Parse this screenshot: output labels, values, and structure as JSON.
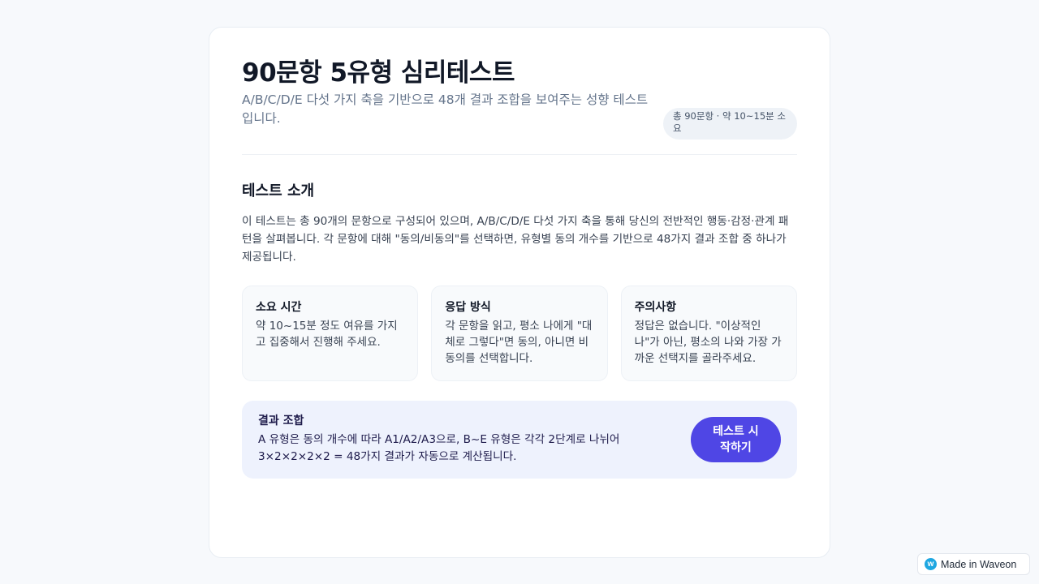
{
  "header": {
    "title": "90문항 5유형 심리테스트",
    "subtitle": "A/B/C/D/E 다섯 가지 축을 기반으로 48개 결과 조합을 보여주는 성향 테스트입니다.",
    "badge": "총 90문항 · 약 10~15분 소요"
  },
  "intro": {
    "title": "테스트 소개",
    "text": "이 테스트는 총 90개의 문항으로 구성되어 있으며, A/B/C/D/E 다섯 가지 축을 통해 당신의 전반적인 행동·감정·관계 패턴을 살펴봅니다. 각 문항에 대해 \"동의/비동의\"를 선택하면, 유형별 동의 개수를 기반으로 48가지 결과 조합 중 하나가 제공됩니다."
  },
  "info_cards": [
    {
      "title": "소요 시간",
      "text": "약 10~15분 정도 여유를 가지고 집중해서 진행해 주세요."
    },
    {
      "title": "응답 방식",
      "text": "각 문항을 읽고, 평소 나에게 \"대체로 그렇다\"면 동의, 아니면 비동의를 선택합니다."
    },
    {
      "title": "주의사항",
      "text": "정답은 없습니다. \"이상적인 나\"가 아닌, 평소의 나와 가장 가까운 선택지를 골라주세요."
    }
  ],
  "result": {
    "title": "결과 조합",
    "text": "A 유형은 동의 개수에 따라 A1/A2/A3으로, B~E 유형은 각각 2단계로 나뉘어 3×2×2×2×2 = 48가지 결과가 자동으로 계산됩니다.",
    "button_label": "테스트 시작하기"
  },
  "footer_badge": {
    "label": "Made in Waveon",
    "logo_letter": "w"
  },
  "colors": {
    "accent": "#4f46e5",
    "result_bg": "#eef2fd",
    "page_bg": "#f7f9fc"
  }
}
